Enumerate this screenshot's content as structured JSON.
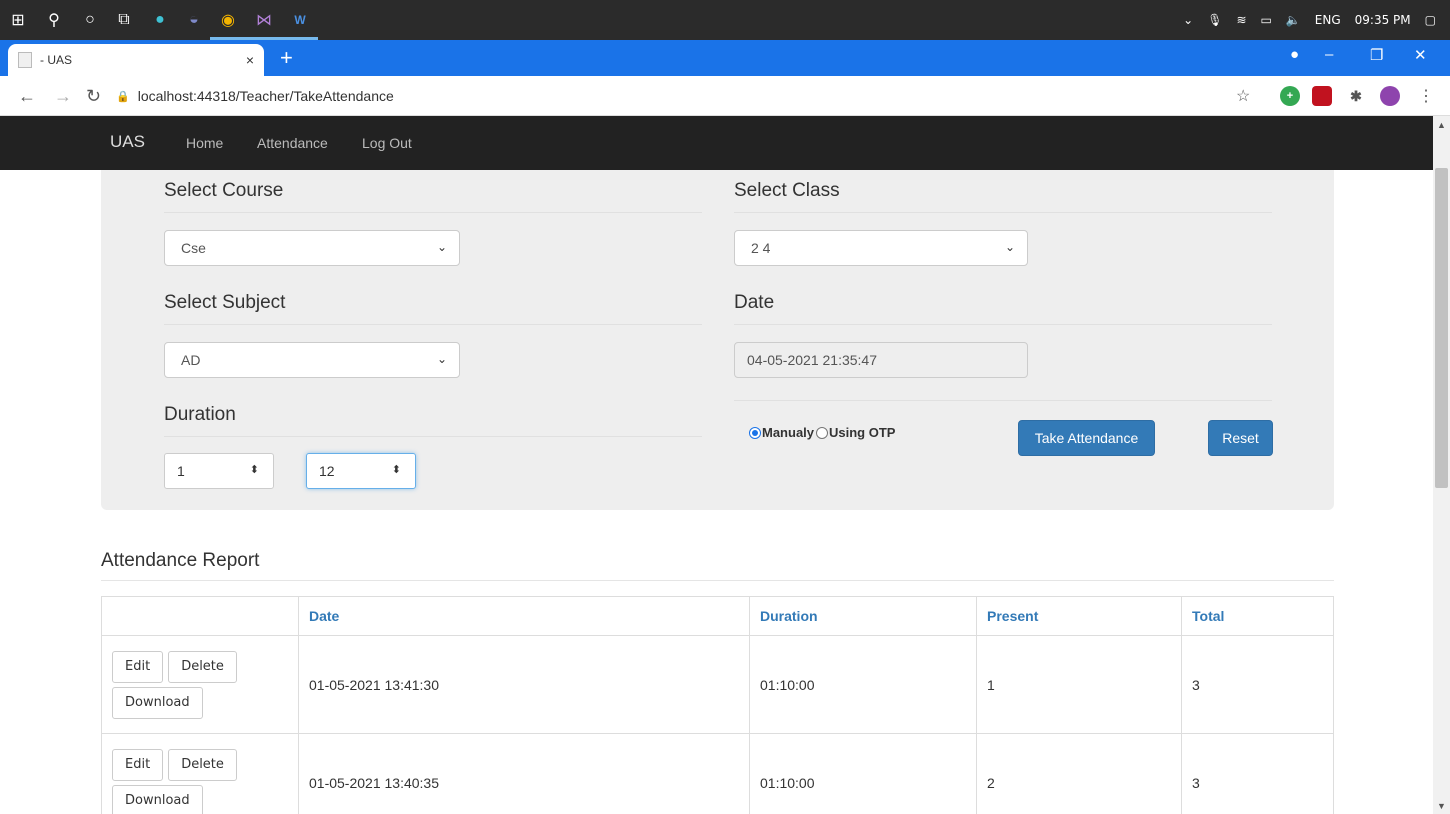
{
  "taskbar": {
    "tray": {
      "lang": "ENG",
      "time": "09:35 PM"
    }
  },
  "browser": {
    "tab_title": "- UAS",
    "tab_close": "×",
    "new_tab": "+",
    "url": "localhost:44318/Teacher/TakeAttendance"
  },
  "navbar": {
    "brand": "UAS",
    "links": [
      "Home",
      "Attendance",
      "Log Out"
    ]
  },
  "form": {
    "course": {
      "label": "Select Course",
      "value": "Cse"
    },
    "class": {
      "label": "Select Class",
      "value": "2 4"
    },
    "subject": {
      "label": "Select Subject",
      "value": "AD"
    },
    "date": {
      "label": "Date",
      "value": "04-05-2021 21:35:47"
    },
    "duration": {
      "label": "Duration",
      "hours": "1",
      "minutes": "12"
    },
    "mode": {
      "option1": "Manualy",
      "option2": "Using OTP",
      "selected": "Manualy"
    },
    "take_button": "Take Attendance",
    "reset_button": "Reset"
  },
  "report": {
    "title": "Attendance Report",
    "columns": [
      "",
      "Date",
      "Duration",
      "Present",
      "Total"
    ],
    "row_actions": {
      "edit": "Edit",
      "delete": "Delete",
      "download": "Download"
    },
    "rows": [
      {
        "date": "01-05-2021 13:41:30",
        "duration": "01:10:00",
        "present": "1",
        "total": "3"
      },
      {
        "date": "01-05-2021 13:40:35",
        "duration": "01:10:00",
        "present": "2",
        "total": "3"
      }
    ]
  },
  "colors": {
    "primary": "#337ab7",
    "navbar": "#222222",
    "chrome_blue": "#1a73e8",
    "panel": "#eeeeee"
  }
}
